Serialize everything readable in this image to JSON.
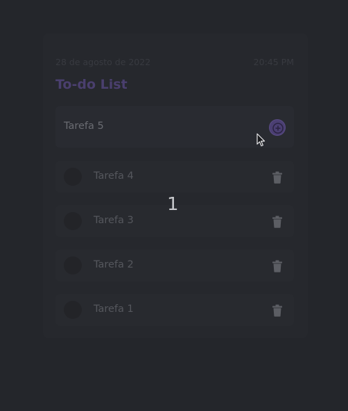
{
  "header": {
    "date": "28 de agosto de 2022",
    "time": "20:45 PM",
    "title": "To-do List"
  },
  "new_task": {
    "value": "Tarefa 5"
  },
  "tasks": [
    {
      "label": "Tarefa 4"
    },
    {
      "label": "Tarefa 3"
    },
    {
      "label": "Tarefa 2"
    },
    {
      "label": "Tarefa 1"
    }
  ],
  "overlay": {
    "text": "1"
  },
  "colors": {
    "background": "#24262b",
    "accent": "#4b3f73",
    "title": "#4a3f6e"
  },
  "icons": {
    "add": "plus-circle-icon",
    "delete": "trash-icon",
    "cursor": "mouse-pointer-icon"
  }
}
